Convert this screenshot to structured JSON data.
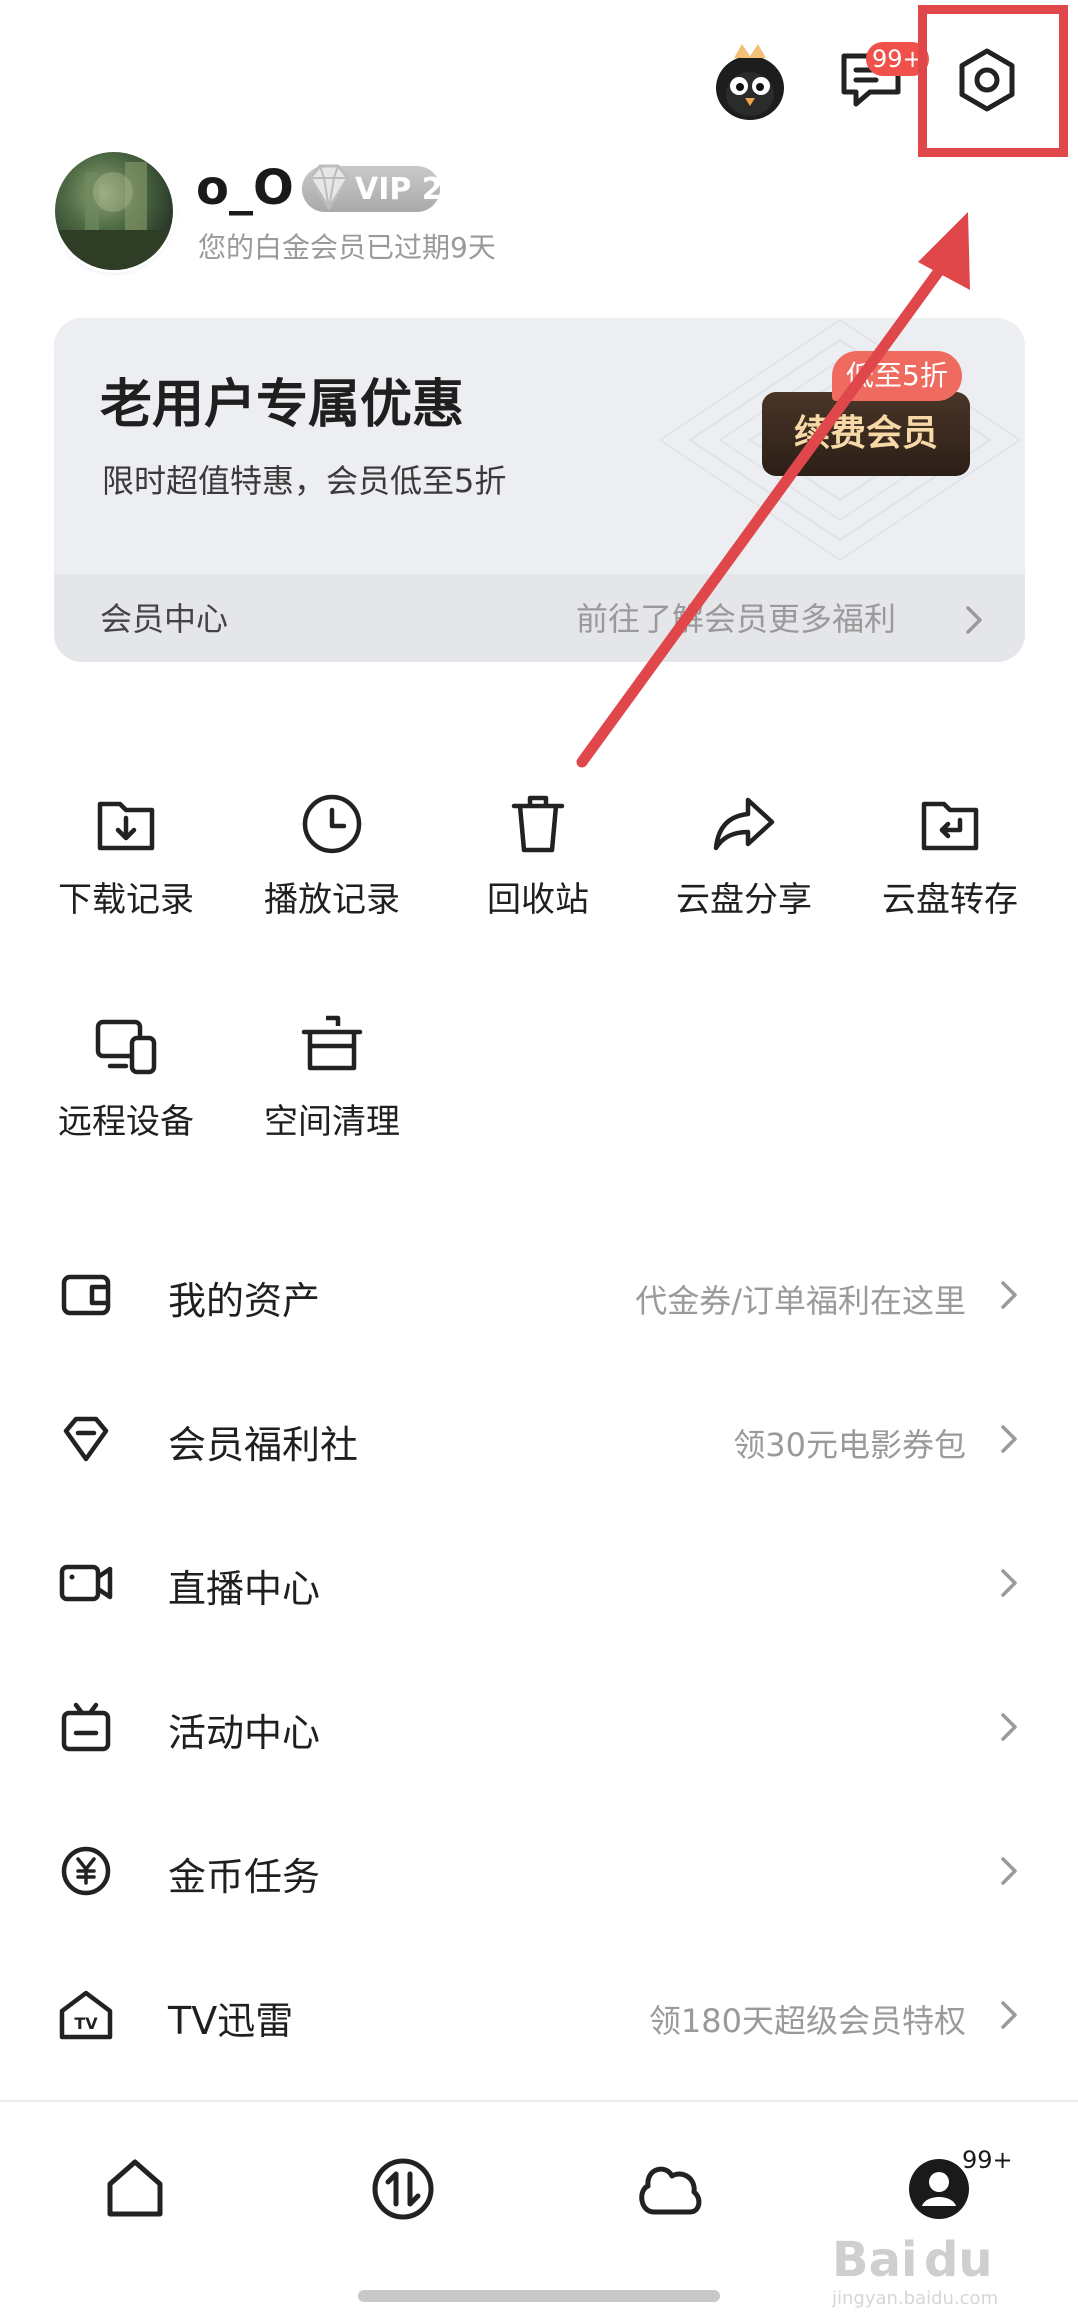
{
  "top": {
    "message_badge": "99+",
    "icons": [
      "mascot-icon",
      "message-icon",
      "settings-icon"
    ]
  },
  "profile": {
    "username": "o_O",
    "vip_label": "VIP 2",
    "subtitle": "您的白金会员已过期9天"
  },
  "promo": {
    "title": "老用户专属优惠",
    "subtitle": "限时超值特惠，会员低至5折",
    "discount_badge": "低至5折",
    "button_label": "续费会员",
    "footer_left": "会员中心",
    "footer_right": "前往了解会员更多福利"
  },
  "grid": [
    {
      "label": "下载记录",
      "icon": "download-folder-icon"
    },
    {
      "label": "播放记录",
      "icon": "clock-icon"
    },
    {
      "label": "回收站",
      "icon": "trash-icon"
    },
    {
      "label": "云盘分享",
      "icon": "share-icon"
    },
    {
      "label": "云盘转存",
      "icon": "folder-return-icon"
    },
    {
      "label": "远程设备",
      "icon": "devices-icon"
    },
    {
      "label": "空间清理",
      "icon": "cleanup-pot-icon"
    }
  ],
  "list": [
    {
      "label": "我的资产",
      "sub": "代金券/订单福利在这里",
      "icon": "wallet-icon"
    },
    {
      "label": "会员福利社",
      "sub": "领30元电影券包",
      "icon": "gem-icon"
    },
    {
      "label": "直播中心",
      "sub": "",
      "icon": "video-icon"
    },
    {
      "label": "活动中心",
      "sub": "",
      "icon": "tv-box-icon"
    },
    {
      "label": "金币任务",
      "sub": "",
      "icon": "coin-icon"
    },
    {
      "label": "TV迅雷",
      "sub": "领180天超级会员特权",
      "icon": "tv-house-icon"
    }
  ],
  "nav": {
    "items": [
      "home-icon",
      "transfer-icon",
      "cloud-icon",
      "profile-icon"
    ],
    "badge": "99+"
  },
  "watermark": "Baidu经验"
}
